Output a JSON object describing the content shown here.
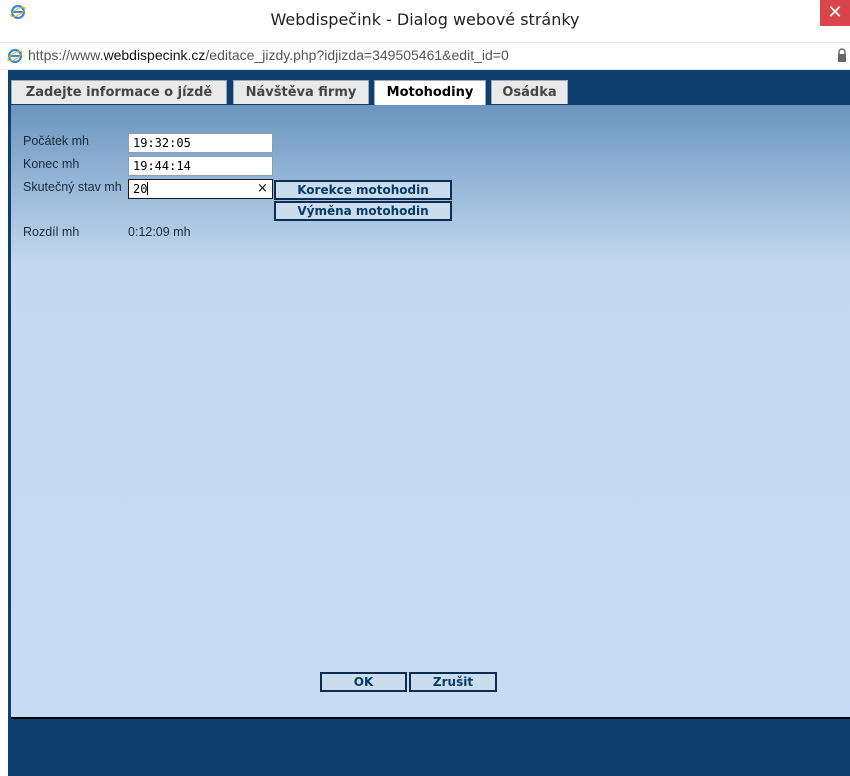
{
  "window": {
    "title": "Webdispečink - Dialog webové stránky",
    "close_glyph": "✕"
  },
  "address": {
    "prefix": "https://www.",
    "domain": "webdispecink.cz",
    "path": "/editace_jizdy.php?idjizda=349505461&edit_id=0"
  },
  "tabs": [
    {
      "label": "Zadejte informace o jízdě",
      "active": false
    },
    {
      "label": "Návštěva firmy",
      "active": false
    },
    {
      "label": "Motohodiny",
      "active": true
    },
    {
      "label": "Osádka",
      "active": false
    }
  ],
  "form": {
    "start_label": "Počátek mh",
    "start_value": "19:32:05",
    "end_label": "Konec mh",
    "end_value": "19:44:14",
    "actual_label": "Skutečný stav mh",
    "actual_value": "20",
    "clear_glyph": "×",
    "correction_button": "Korekce motohodin",
    "replace_button": "Výměna motohodin",
    "diff_label": "Rozdíl mh",
    "diff_value": "0:12:09 mh"
  },
  "footer": {
    "ok": "OK",
    "cancel": "Zrušit"
  },
  "colors": {
    "frame": "#0e3f6f",
    "panel_top": "#6b95bf",
    "panel_bottom": "#c6dcf2",
    "close": "#d9454b"
  }
}
